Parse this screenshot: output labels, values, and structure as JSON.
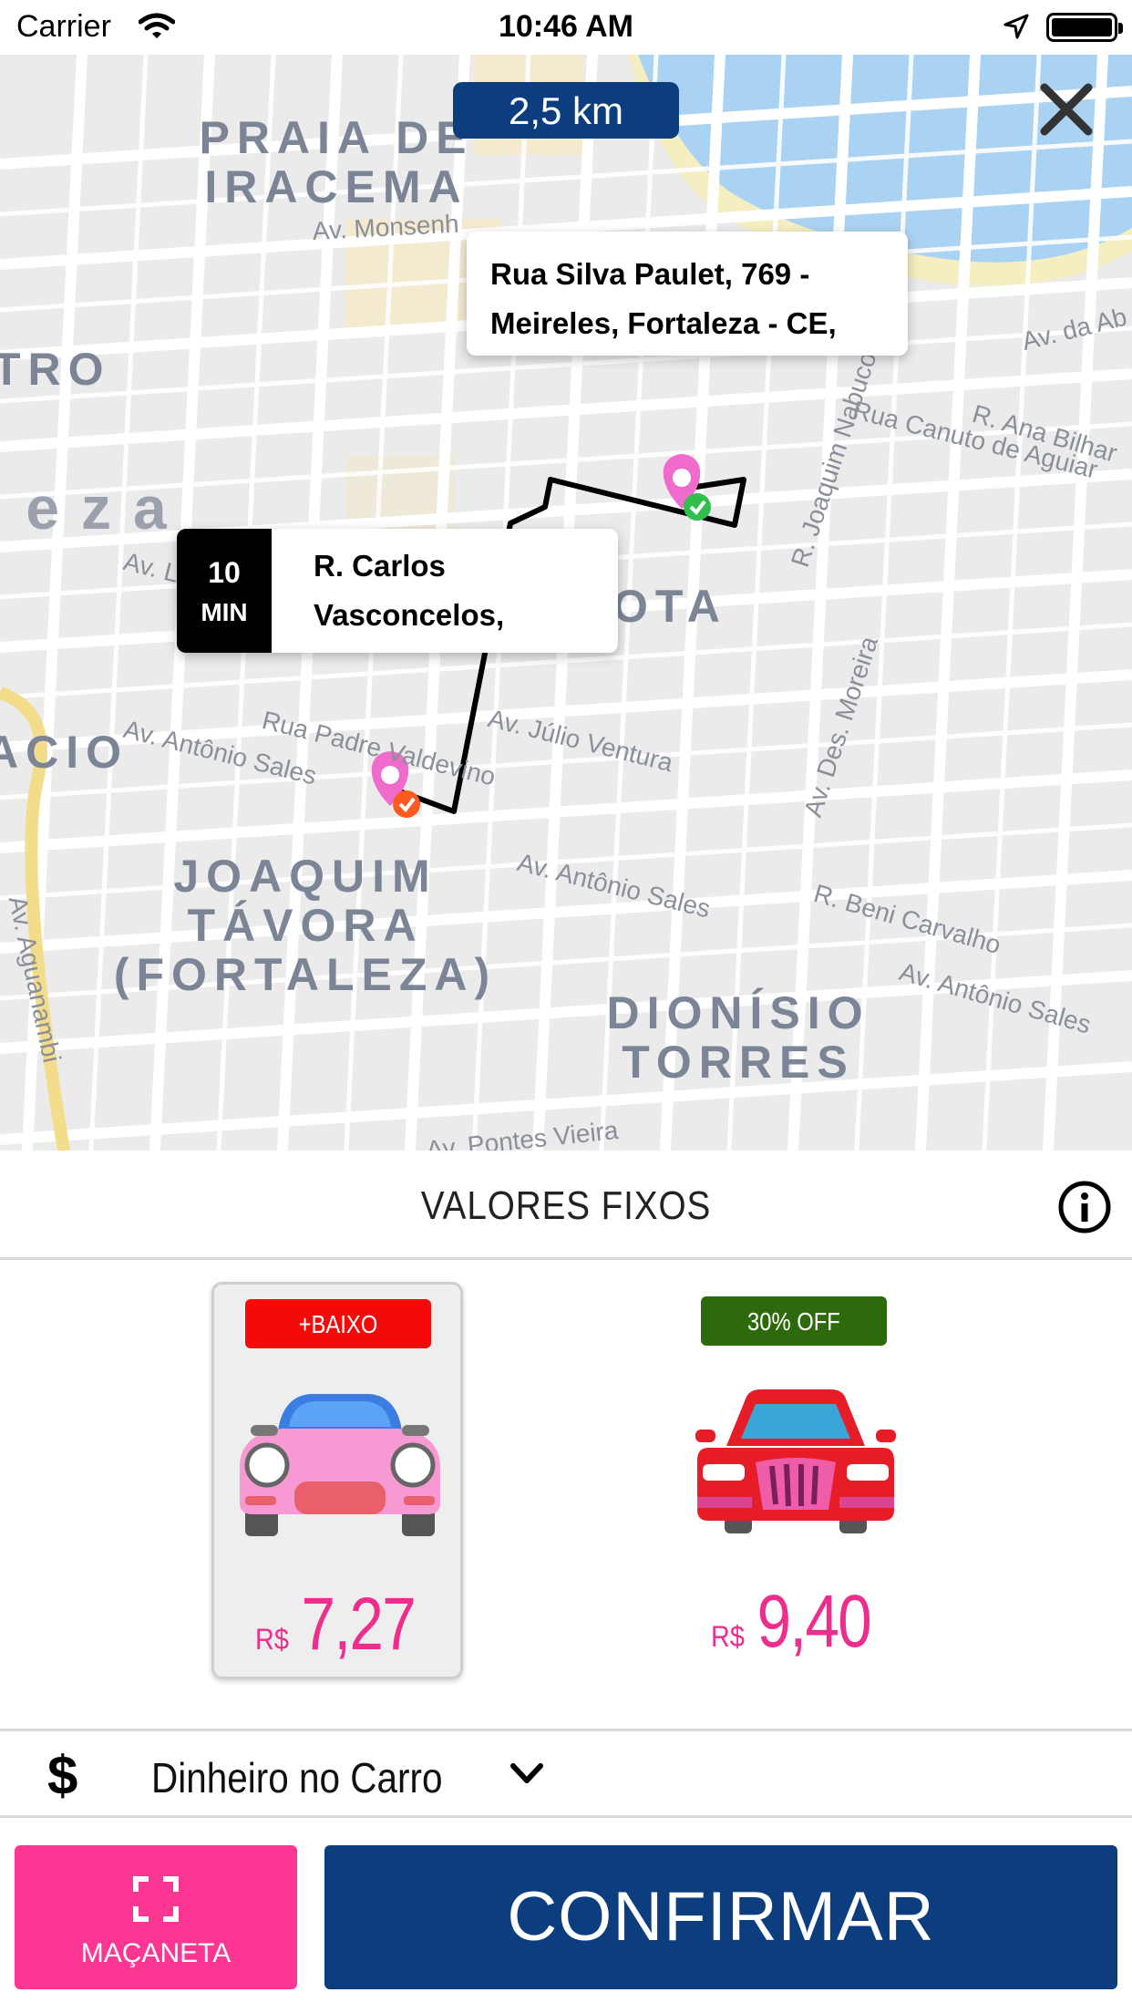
{
  "status_bar": {
    "carrier": "Carrier",
    "time": "10:46 AM"
  },
  "map": {
    "distance": "2,5 km",
    "areas": [
      "PRAIA DE\nIRACEMA",
      "TRO",
      "leza",
      "OTA",
      "ACIO",
      "JOAQUIM\nTÁVORA\n(FORTALEZA)",
      "DIONÍSIO\nTORRES"
    ],
    "streets": [
      "Av. Monsenh",
      "Av. da Ab",
      "Rua Canuto de Aguiar",
      "R. Ana Bilhar",
      "R. Joaquim Nabuco",
      "Av. Júlio Ventura",
      "Rua Padre Valdevino",
      "Av. Antônio Sales",
      "Av. Antônio Sales",
      "Av. Des. Moreira",
      "R. Beni Carvalho",
      "Av. Antônio Sales",
      "Av. Pontes Vieira",
      "Av. Aguanambi",
      "Av. L"
    ],
    "destination_address": "Rua Silva Paulet, 769 - Meireles, Fortaleza - CE,",
    "origin": {
      "eta_number": "10",
      "eta_unit": "MIN",
      "address": "R. Carlos Vasconcelos,"
    }
  },
  "panel": {
    "title": "VALORES FIXOS",
    "options": [
      {
        "badge": "+BAIXO",
        "badge_color": "#f50a0a",
        "currency": "R$",
        "price": "7,27",
        "selected": true
      },
      {
        "badge": "30% OFF",
        "badge_color": "#2d6a0c",
        "currency": "R$",
        "price": "9,40",
        "selected": false
      }
    ],
    "payment": {
      "icon": "$",
      "label": "Dinheiro no Carro"
    },
    "buttons": {
      "handle_label": "MAÇANETA",
      "confirm_label": "CONFIRMAR"
    }
  },
  "colors": {
    "brand_blue": "#0c3d7e",
    "brand_pink": "#fd3593",
    "price_pink": "#ee2e8d"
  }
}
